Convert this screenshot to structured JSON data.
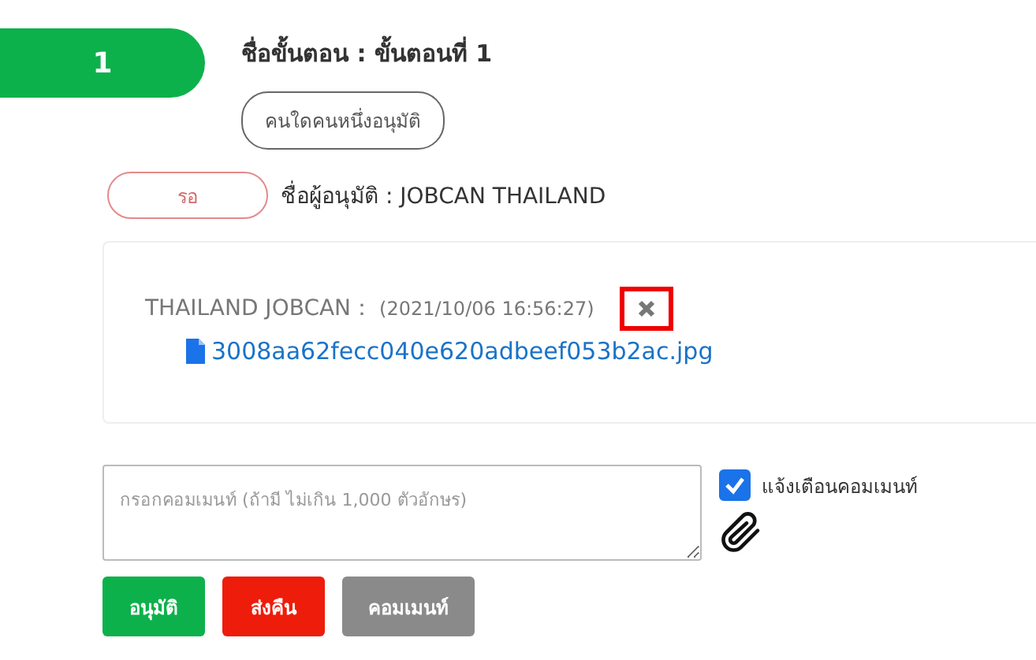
{
  "step": {
    "number": "1",
    "title": "ชื่อขั้นตอน : ขั้นตอนที่ 1",
    "approval_type": "คนใดคนหนึ่งอนุมัติ"
  },
  "approver": {
    "status": "รอ",
    "name": "ชื่อผู้อนุมัติ : JOBCAN THAILAND"
  },
  "comment": {
    "author": "THAILAND JOBCAN：",
    "time": "(2021/10/06 16:56:27)",
    "delete_highlighted": true,
    "attachment": "3008aa62fecc040e620adbeef053b2ac.jpg"
  },
  "comment_field": {
    "placeholder": "กรอกคอมเมนท์ (ถ้ามี ไม่เกิน 1,000 ตัวอักษร)"
  },
  "notify": {
    "label": "แจ้งเตือนคอมเมนท์",
    "checked": true
  },
  "buttons": [
    {
      "label": "อนุมัติ",
      "kind": "approve"
    },
    {
      "label": "ส่งคืน",
      "kind": "return"
    },
    {
      "label": "คอมเมนท์",
      "kind": "comment"
    }
  ]
}
